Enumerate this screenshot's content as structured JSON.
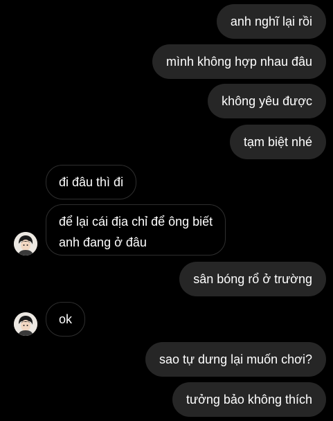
{
  "messages": [
    {
      "sender": "me",
      "text": "anh nghĩ lại rồi"
    },
    {
      "sender": "me",
      "text": "mình không hợp nhau đâu"
    },
    {
      "sender": "me",
      "text": "không yêu được"
    },
    {
      "sender": "me",
      "text": "tạm biệt nhé"
    },
    {
      "sender": "them",
      "text": "đi đâu thì đi"
    },
    {
      "sender": "them",
      "lines": [
        "để lại cái địa chỉ để ông biết",
        "anh đang ở đâu"
      ]
    },
    {
      "sender": "me",
      "text": "sân bóng rổ ở trường"
    },
    {
      "sender": "them",
      "text": "ok"
    },
    {
      "sender": "me",
      "text": "sao tự dưng lại muốn chơi?"
    },
    {
      "sender": "me",
      "text": "tưởng bảo không thích"
    }
  ],
  "colors": {
    "background": "#000000",
    "sent_bubble": "#262626",
    "received_border": "#2f2f2f",
    "text": "#ffffff"
  },
  "icons": {
    "avatar": "contact-avatar-photo"
  }
}
